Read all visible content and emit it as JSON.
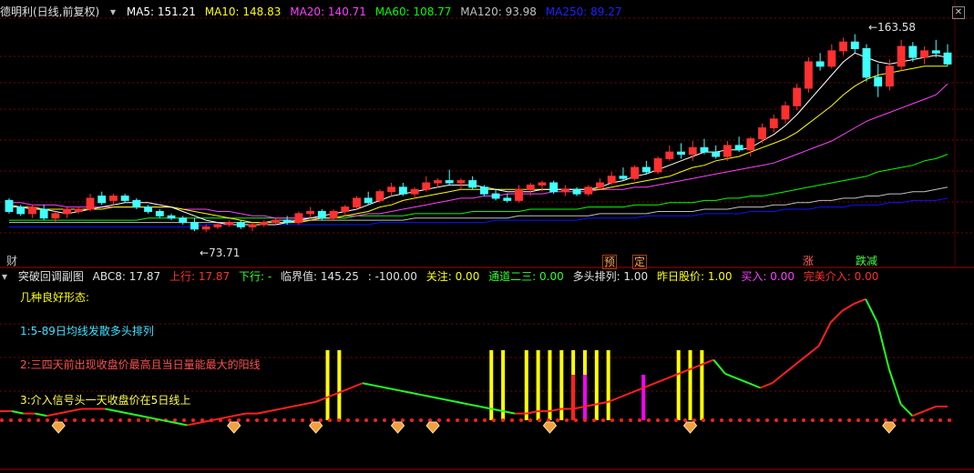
{
  "header": {
    "title": "德明利(日线,前复权)",
    "ma5": "MA5: 151.21",
    "ma10": "MA10: 148.83",
    "ma20": "MA20: 140.71",
    "ma60": "MA60: 108.77",
    "ma120": "MA120: 93.98",
    "ma250": "MA250: 89.27",
    "high_label": "163.58",
    "low_label": "73.71"
  },
  "event_tags": {
    "cai": "财",
    "yu": "预",
    "ding": "定",
    "zhang": "涨",
    "diejian": "跌减"
  },
  "sub_header": {
    "title": "突破回调副图",
    "abc8": "ABC8: 17.87",
    "shangxing": "上行: 17.87",
    "xiaxing": "下行: -",
    "linjie": "临界值: 145.25",
    "minus100": ": -100.00",
    "guanzhu": "关注: 0.00",
    "tongdao": "通道二三: 0.00",
    "duotou": "多头排列: 1.00",
    "zuori": "昨日股价: 1.00",
    "mairu": "买入: 0.00",
    "wanmei": "完美介入: 0.00"
  },
  "notes": {
    "n0": "几种良好形态:",
    "n1": "1:5-89日均线发散多头排列",
    "n2": "2:三四天前出现收盘价最高且当日量能最大的阳线",
    "n3": "3:介入信号头一天收盘价在5日线上"
  },
  "colors": {
    "background": "#000000",
    "grid": "#7a0000",
    "ma5": "#ffffff",
    "ma10": "#ffff00",
    "ma20": "#ff40ff",
    "ma60": "#00ff00",
    "ma120": "#c0c0c0",
    "ma250": "#1010ff",
    "up_candle": "#ff3030",
    "down_candle": "#40ffff",
    "signal_yellow": "#ffff00",
    "signal_red": "#ff2020",
    "signal_magenta": "#ff00ff"
  },
  "chart_data": [
    {
      "type": "candlestick",
      "title": "德明利(日线,前复权)",
      "ylim": [
        65,
        170
      ],
      "candles": [
        [
          88,
          89,
          82,
          83
        ],
        [
          85,
          86,
          81,
          82
        ],
        [
          82,
          86,
          80,
          85
        ],
        [
          84,
          86,
          79,
          80
        ],
        [
          80,
          83,
          78,
          82
        ],
        [
          82,
          85,
          80,
          84
        ],
        [
          83,
          85,
          82,
          84
        ],
        [
          84,
          91,
          83,
          89
        ],
        [
          90,
          92,
          86,
          87
        ],
        [
          88,
          91,
          86,
          90
        ],
        [
          90,
          91,
          87,
          88
        ],
        [
          88,
          89,
          84,
          85
        ],
        [
          85,
          86,
          82,
          83
        ],
        [
          83,
          84,
          80,
          81
        ],
        [
          81,
          82,
          79,
          80
        ],
        [
          80,
          81,
          77,
          78
        ],
        [
          78,
          80,
          74,
          75
        ],
        [
          75,
          77,
          73.71,
          76
        ],
        [
          76,
          78,
          75,
          77
        ],
        [
          77,
          79,
          76,
          78
        ],
        [
          78,
          79,
          75,
          76
        ],
        [
          76,
          78,
          74,
          77
        ],
        [
          77,
          79,
          76,
          78
        ],
        [
          78,
          80,
          77,
          79
        ],
        [
          79,
          81,
          77,
          78
        ],
        [
          78,
          83,
          77,
          82
        ],
        [
          82,
          85,
          80,
          83
        ],
        [
          83,
          84,
          79,
          80
        ],
        [
          80,
          84,
          79,
          83
        ],
        [
          83,
          86,
          81,
          85
        ],
        [
          85,
          90,
          84,
          89
        ],
        [
          89,
          92,
          86,
          87
        ],
        [
          88,
          93,
          87,
          92
        ],
        [
          92,
          96,
          90,
          94
        ],
        [
          94,
          96,
          90,
          91
        ],
        [
          91,
          94,
          89,
          93
        ],
        [
          93,
          99,
          92,
          96
        ],
        [
          96,
          98,
          94,
          97
        ],
        [
          97,
          102,
          95,
          96
        ],
        [
          96,
          98,
          93,
          97
        ],
        [
          97,
          99,
          93,
          94
        ],
        [
          94,
          95,
          90,
          91
        ],
        [
          91,
          93,
          88,
          89
        ],
        [
          89,
          91,
          87,
          88
        ],
        [
          88,
          95,
          87,
          93
        ],
        [
          93,
          96,
          90,
          95
        ],
        [
          95,
          97,
          92,
          96
        ],
        [
          96,
          97,
          91,
          92
        ],
        [
          92,
          95,
          90,
          93
        ],
        [
          93,
          94,
          90,
          91
        ],
        [
          91,
          95,
          90,
          94
        ],
        [
          94,
          98,
          93,
          96
        ],
        [
          96,
          101,
          95,
          99
        ],
        [
          99,
          103,
          97,
          98
        ],
        [
          98,
          104,
          97,
          103
        ],
        [
          103,
          106,
          100,
          101
        ],
        [
          101,
          108,
          100,
          107
        ],
        [
          107,
          113,
          106,
          110
        ],
        [
          110,
          114,
          107,
          109
        ],
        [
          109,
          115,
          106,
          112
        ],
        [
          112,
          116,
          109,
          110
        ],
        [
          110,
          113,
          107,
          108
        ],
        [
          108,
          115,
          106,
          113
        ],
        [
          113,
          117,
          110,
          111
        ],
        [
          111,
          117,
          108,
          116
        ],
        [
          116,
          123,
          114,
          121
        ],
        [
          121,
          127,
          119,
          125
        ],
        [
          125,
          133,
          123,
          131
        ],
        [
          131,
          141,
          129,
          139
        ],
        [
          139,
          153,
          137,
          151
        ],
        [
          151,
          155,
          147,
          149
        ],
        [
          149,
          159,
          148,
          156
        ],
        [
          156,
          162,
          154,
          160
        ],
        [
          160,
          163.58,
          155,
          157
        ],
        [
          157,
          159,
          142,
          144
        ],
        [
          144,
          150,
          135,
          140
        ],
        [
          140,
          152,
          138,
          149
        ],
        [
          149,
          161,
          147,
          158
        ],
        [
          158,
          160,
          151,
          153
        ],
        [
          153,
          158,
          150,
          156
        ],
        [
          156,
          161,
          153,
          155
        ],
        [
          155,
          159,
          149,
          150
        ]
      ],
      "ma5": [
        86,
        85,
        84,
        84,
        83,
        82,
        83,
        84,
        85,
        86,
        87,
        87,
        87,
        86,
        85,
        83,
        81,
        79,
        78,
        77,
        77,
        77,
        77,
        77,
        78,
        79,
        80,
        81,
        82,
        83,
        84,
        86,
        88,
        90,
        91,
        92,
        93,
        94,
        95,
        95,
        95,
        94,
        93,
        92,
        92,
        92,
        93,
        93,
        93,
        93,
        93,
        94,
        96,
        97,
        99,
        100,
        102,
        104,
        106,
        108,
        110,
        110,
        111,
        111,
        112,
        115,
        118,
        122,
        127,
        133,
        139,
        145,
        151,
        155,
        153,
        151,
        150,
        151,
        152,
        153,
        154,
        153
      ],
      "ma10": [
        85,
        85,
        85,
        84,
        84,
        84,
        84,
        84,
        84,
        85,
        85,
        85,
        85,
        85,
        85,
        84,
        83,
        82,
        81,
        80,
        79,
        78,
        78,
        78,
        78,
        78,
        79,
        80,
        80,
        81,
        82,
        83,
        85,
        86,
        88,
        89,
        90,
        91,
        92,
        93,
        93,
        93,
        93,
        93,
        93,
        93,
        93,
        93,
        93,
        93,
        93,
        93,
        94,
        95,
        96,
        97,
        98,
        99,
        101,
        103,
        104,
        106,
        107,
        108,
        110,
        112,
        114,
        116,
        119,
        123,
        127,
        131,
        136,
        140,
        143,
        145,
        146,
        147,
        148,
        149,
        149,
        149
      ],
      "ma20": [
        87,
        87,
        86,
        86,
        86,
        85,
        85,
        85,
        85,
        85,
        85,
        85,
        85,
        85,
        85,
        84,
        84,
        84,
        83,
        83,
        82,
        81,
        81,
        80,
        80,
        80,
        80,
        80,
        80,
        81,
        81,
        82,
        82,
        83,
        84,
        85,
        86,
        87,
        88,
        89,
        89,
        90,
        90,
        91,
        91,
        91,
        91,
        92,
        92,
        92,
        92,
        93,
        93,
        93,
        94,
        94,
        95,
        96,
        97,
        98,
        99,
        100,
        101,
        102,
        103,
        104,
        105,
        107,
        109,
        111,
        113,
        115,
        118,
        121,
        124,
        126,
        128,
        130,
        132,
        134,
        136,
        141
      ],
      "ma60": [
        79,
        79,
        79,
        79,
        79,
        79,
        79,
        79,
        79,
        79,
        79,
        79,
        80,
        80,
        80,
        80,
        80,
        80,
        80,
        80,
        80,
        80,
        80,
        80,
        80,
        80,
        80,
        80,
        80,
        80,
        81,
        81,
        81,
        81,
        81,
        82,
        82,
        82,
        82,
        82,
        83,
        83,
        83,
        83,
        83,
        84,
        84,
        84,
        84,
        84,
        85,
        85,
        85,
        85,
        86,
        86,
        86,
        87,
        87,
        87,
        88,
        88,
        89,
        89,
        90,
        90,
        91,
        92,
        93,
        94,
        95,
        96,
        97,
        98,
        99,
        101,
        102,
        103,
        104,
        106,
        107,
        109
      ],
      "ma120": [
        78,
        78,
        78,
        78,
        78,
        78,
        78,
        78,
        78,
        78,
        78,
        78,
        78,
        78,
        78,
        78,
        78,
        78,
        78,
        78,
        78,
        78,
        78,
        79,
        79,
        79,
        79,
        79,
        79,
        79,
        79,
        79,
        79,
        79,
        79,
        80,
        80,
        80,
        80,
        80,
        80,
        80,
        80,
        80,
        81,
        81,
        81,
        81,
        81,
        81,
        81,
        82,
        82,
        82,
        82,
        82,
        83,
        83,
        83,
        83,
        84,
        84,
        84,
        85,
        85,
        85,
        86,
        86,
        87,
        87,
        88,
        88,
        89,
        89,
        90,
        90,
        91,
        91,
        92,
        92,
        93,
        94
      ],
      "ma250": [
        76,
        76,
        76,
        76,
        76,
        76,
        76,
        76,
        76,
        76,
        76,
        76,
        76,
        76,
        76,
        76,
        76,
        77,
        77,
        77,
        77,
        77,
        77,
        77,
        77,
        77,
        77,
        77,
        77,
        77,
        77,
        77,
        78,
        78,
        78,
        78,
        78,
        78,
        78,
        78,
        78,
        78,
        79,
        79,
        79,
        79,
        79,
        79,
        79,
        79,
        80,
        80,
        80,
        80,
        80,
        81,
        81,
        81,
        81,
        81,
        82,
        82,
        82,
        82,
        83,
        83,
        83,
        84,
        84,
        84,
        85,
        85,
        85,
        86,
        86,
        86,
        87,
        87,
        88,
        88,
        88,
        89
      ]
    },
    {
      "type": "line",
      "title": "突破回调副图",
      "series": [
        {
          "name": "ABC8",
          "values": [
            2,
            2,
            1,
            1,
            0,
            1,
            2,
            3,
            3,
            3,
            2,
            1,
            0,
            -1,
            -2,
            -3,
            -4,
            -3,
            -2,
            -1,
            0,
            1,
            1,
            2,
            3,
            4,
            5,
            6,
            8,
            10,
            12,
            14,
            13,
            12,
            11,
            10,
            9,
            8,
            7,
            6,
            5,
            4,
            3,
            2,
            1,
            1,
            2,
            2,
            3,
            3,
            4,
            5,
            6,
            8,
            10,
            12,
            14,
            16,
            18,
            20,
            22,
            24,
            18,
            16,
            14,
            12,
            14,
            18,
            22,
            26,
            30,
            40,
            45,
            48,
            50,
            40,
            20,
            5,
            0,
            2,
            4,
            4
          ]
        }
      ],
      "signals_yellow": [
        28,
        29,
        42,
        43,
        45,
        46,
        47,
        48,
        49,
        50,
        51,
        52,
        58,
        59,
        60
      ],
      "signals_red": [
        49
      ],
      "signals_magenta": [
        50,
        55
      ],
      "diamonds": [
        5,
        20,
        27,
        34,
        37,
        47,
        59,
        76
      ]
    }
  ]
}
